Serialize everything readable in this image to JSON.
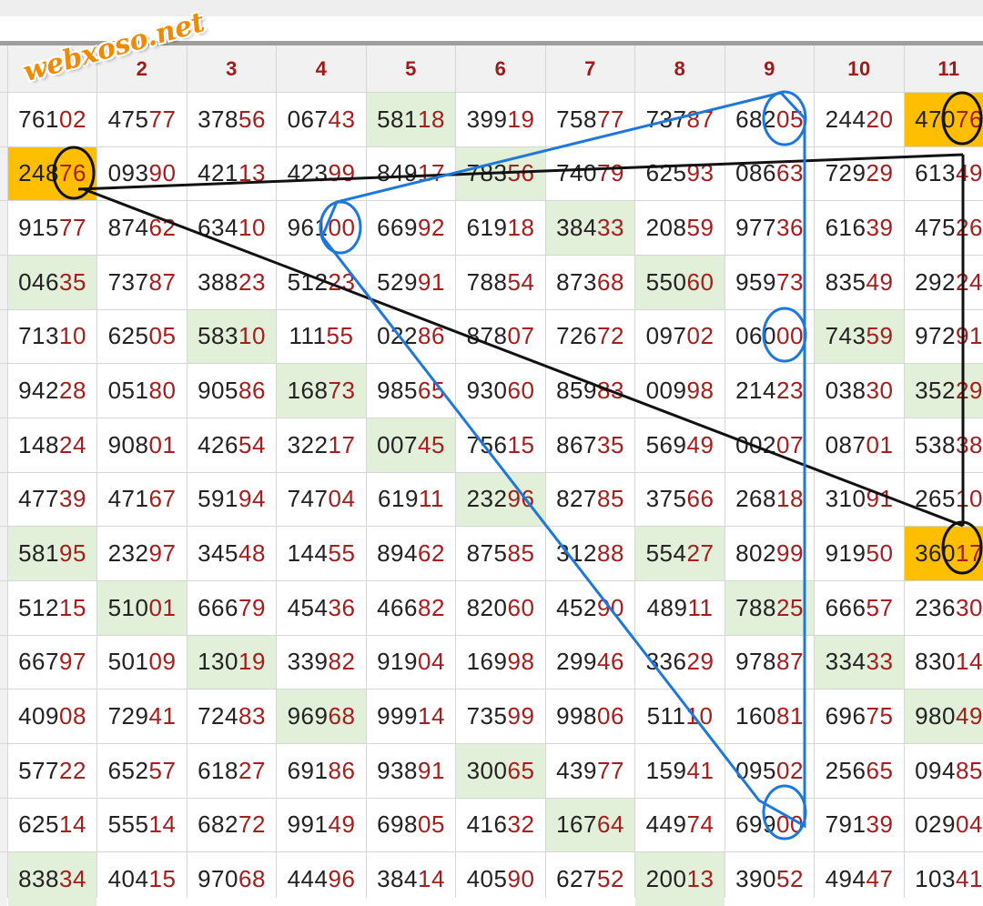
{
  "brand": {
    "logo_text": "webxoso.net"
  },
  "colors": {
    "header_text": "#9b1c1c",
    "number_tail": "#a51d1d",
    "cell_highlight": "#e2f0d9",
    "cell_match": "#ffbf00",
    "line_black": "#111111",
    "line_blue": "#1e78dc"
  },
  "table": {
    "columns": [
      "",
      "",
      "2",
      "3",
      "4",
      "5",
      "6",
      "7",
      "8",
      "9",
      "10",
      "11"
    ],
    "rows": [
      [
        "76102",
        "47577",
        "37856",
        "06743",
        "58118",
        "39919",
        "75877",
        "73787",
        "68205",
        "24420",
        "47076"
      ],
      [
        "24876",
        "09390",
        "42113",
        "42399",
        "84917",
        "78356",
        "74079",
        "62593",
        "08663",
        "72929",
        "61349"
      ],
      [
        "91577",
        "87462",
        "63410",
        "96100",
        "66992",
        "61918",
        "38433",
        "20859",
        "97736",
        "61639",
        "47526"
      ],
      [
        "04635",
        "73787",
        "38823",
        "51223",
        "52991",
        "78854",
        "87368",
        "55060",
        "95973",
        "83549",
        "29224"
      ],
      [
        "71310",
        "62505",
        "58310",
        "11155",
        "02286",
        "87807",
        "72672",
        "09702",
        "06000",
        "74359",
        "97291"
      ],
      [
        "94228",
        "05180",
        "90586",
        "16873",
        "98565",
        "93060",
        "85983",
        "00998",
        "21423",
        "03830",
        "35229"
      ],
      [
        "14824",
        "90801",
        "42654",
        "32217",
        "00745",
        "75615",
        "86735",
        "56949",
        "00207",
        "08701",
        "53838"
      ],
      [
        "47739",
        "47167",
        "59194",
        "74704",
        "61911",
        "23296",
        "82785",
        "37566",
        "26818",
        "31091",
        "26510"
      ],
      [
        "58195",
        "23297",
        "34548",
        "14455",
        "89462",
        "87585",
        "31288",
        "55427",
        "80299",
        "91950",
        "36017"
      ],
      [
        "51215",
        "51001",
        "66679",
        "45436",
        "46682",
        "82060",
        "45290",
        "48911",
        "78825",
        "66657",
        "23630"
      ],
      [
        "66797",
        "50109",
        "13019",
        "33982",
        "91904",
        "16998",
        "29946",
        "33629",
        "97887",
        "33433",
        "83014"
      ],
      [
        "40908",
        "72941",
        "72483",
        "96968",
        "99914",
        "73599",
        "99806",
        "51110",
        "16081",
        "69675",
        "98049"
      ],
      [
        "57722",
        "65257",
        "61827",
        "69186",
        "93891",
        "30065",
        "43977",
        "15941",
        "09502",
        "25665",
        "09485"
      ],
      [
        "62514",
        "55514",
        "68272",
        "99149",
        "69805",
        "41632",
        "16764",
        "44974",
        "69900",
        "79139",
        "02904"
      ],
      [
        "83834",
        "40415",
        "97068",
        "44496",
        "38414",
        "40590",
        "62752",
        "20013",
        "39052",
        "49447",
        "10341"
      ]
    ],
    "highlights": {
      "green": [
        [
          0,
          4
        ],
        [
          1,
          5
        ],
        [
          2,
          6
        ],
        [
          3,
          0
        ],
        [
          3,
          7
        ],
        [
          4,
          2
        ],
        [
          4,
          9
        ],
        [
          5,
          3
        ],
        [
          5,
          10
        ],
        [
          6,
          4
        ],
        [
          7,
          5
        ],
        [
          8,
          0
        ],
        [
          8,
          7
        ],
        [
          9,
          1
        ],
        [
          9,
          8
        ],
        [
          10,
          2
        ],
        [
          10,
          9
        ],
        [
          11,
          3
        ],
        [
          11,
          10
        ],
        [
          12,
          5
        ],
        [
          13,
          6
        ],
        [
          14,
          0
        ],
        [
          14,
          7
        ]
      ],
      "orange": [
        [
          0,
          10
        ],
        [
          1,
          0
        ],
        [
          8,
          10
        ]
      ]
    }
  }
}
